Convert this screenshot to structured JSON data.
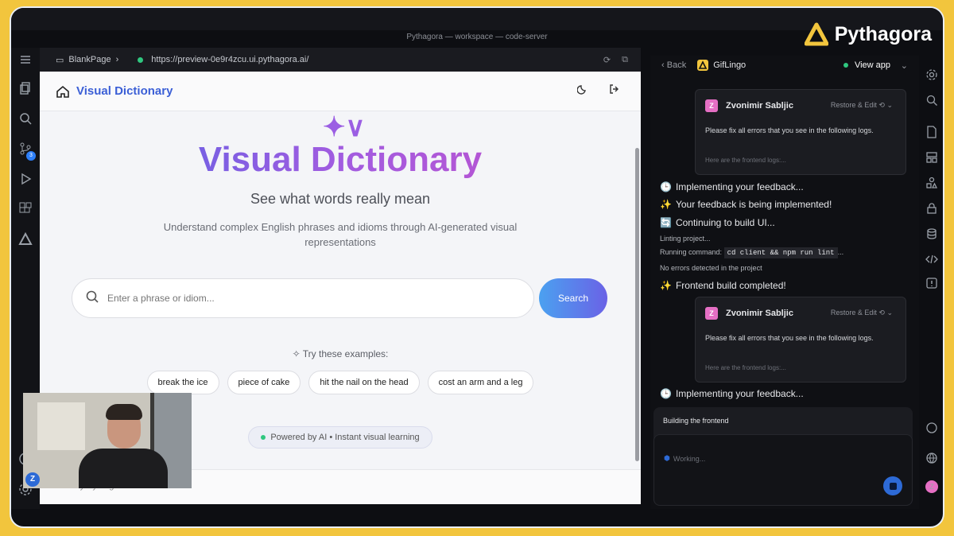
{
  "window": {
    "title": "Pythagora — workspace — code-server",
    "brand": "Pythagora"
  },
  "browser": {
    "page_label": "BlankPage",
    "url": "https://preview-0e9r4zcu.ui.pythagora.ai/"
  },
  "app": {
    "name": "Visual Dictionary",
    "hero_title": "Visual Dictionary",
    "subtitle": "See what words really mean",
    "description": "Understand complex English phrases and idioms through AI-generated visual representations",
    "search_placeholder": "Enter a phrase or idiom...",
    "search_button": "Search",
    "examples_label": "Try these examples:",
    "examples": [
      "break the ice",
      "piece of cake",
      "hit the nail on the head",
      "cost an arm and a leg"
    ],
    "powered": "Powered by AI • Instant visual learning",
    "footer": "Built by Pythagora"
  },
  "activity_badge": "3",
  "webcam_avatar": "Z",
  "panel": {
    "back": "Back",
    "app_name": "GifLingo",
    "view_app": "View app",
    "cards": [
      {
        "user": "Zvonimir Sabljic",
        "avatar": "Z",
        "restore": "Restore & Edit",
        "message": "Please fix all errors that you see in the following logs.",
        "logs": "Here are the frontend logs:..."
      },
      {
        "user": "Zvonimir Sabljic",
        "avatar": "Z",
        "restore": "Restore & Edit",
        "message": "Please fix all errors that you see in the following logs.",
        "logs": "Here are the frontend logs:..."
      }
    ],
    "status": {
      "implementing1": "Implementing your feedback...",
      "being_implemented": "Your feedback is being implemented!",
      "continuing": "Continuing to build UI...",
      "linting": "Linting project...",
      "running_label": "Running command:",
      "command": "cd client  && npm run lint",
      "command_ellipsis": "...",
      "no_errors": "No errors detected in the project",
      "frontend_completed": "Frontend build completed!",
      "implementing2": "Implementing your feedback..."
    },
    "building": "Building the frontend",
    "working": "Working...",
    "user_avatar": "Z"
  },
  "colors": {
    "accent": "#2d6ad6",
    "frame": "#f2c53d",
    "title_gradient": [
      "#4a63e6",
      "#c64fc8"
    ]
  }
}
